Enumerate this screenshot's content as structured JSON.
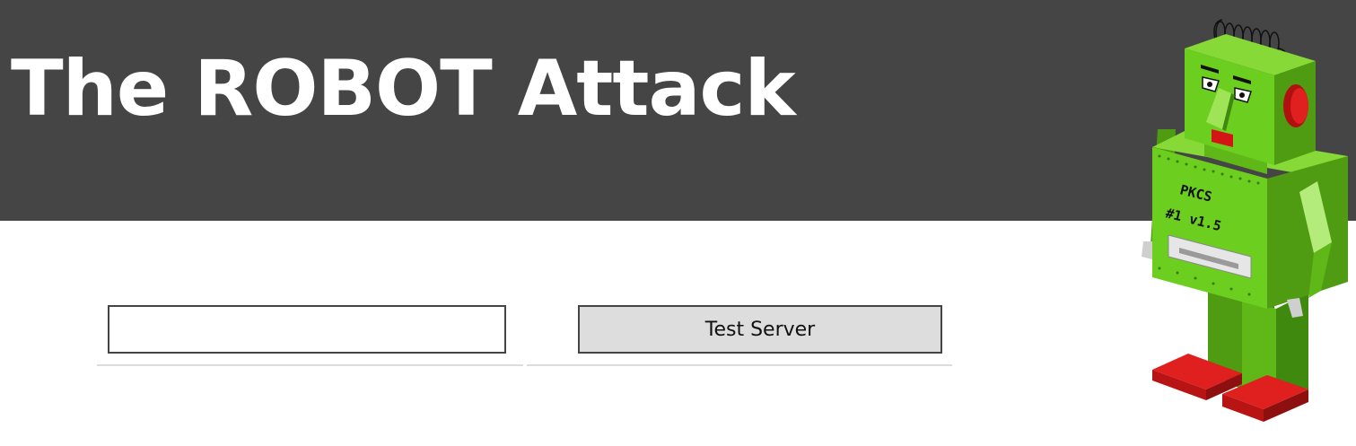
{
  "header": {
    "title": "The ROBOT Attack"
  },
  "form": {
    "host_value": "",
    "button_label": "Test Server"
  },
  "robot": {
    "chest_line1": "PKCS",
    "chest_line2": "#1 v1.5"
  },
  "colors": {
    "header_bg": "#454545",
    "robot_green": "#6ccf1f",
    "robot_shoes": "#e01f1f"
  }
}
